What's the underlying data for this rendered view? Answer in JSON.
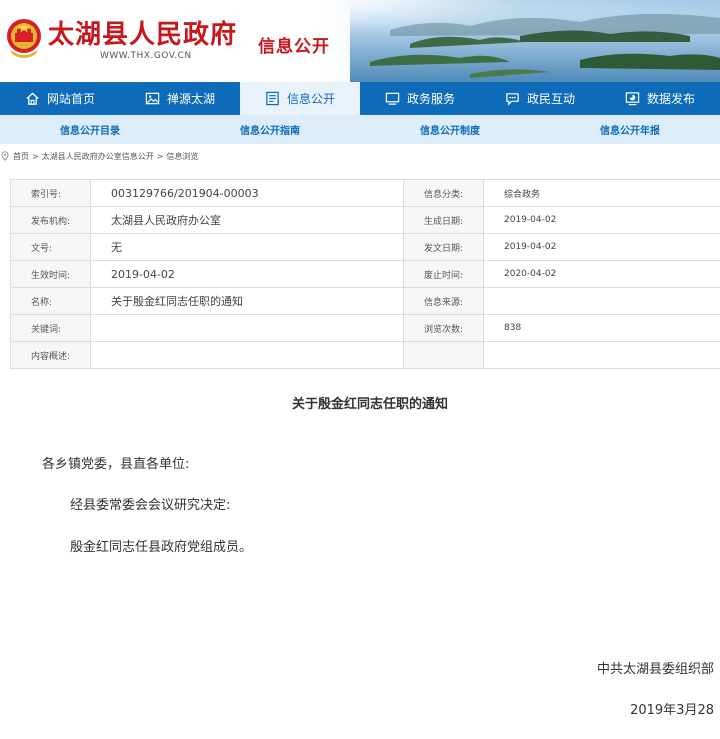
{
  "header": {
    "site_name": "太湖县人民政府",
    "site_url": "WWW.THX.GOV.CN",
    "slogan": "信息公开",
    "emblem_icon": "national-emblem-icon",
    "brand_color": "#c8161d"
  },
  "nav": {
    "color": "#0e6bb9",
    "items": [
      {
        "label": "网站首页",
        "icon": "home-icon"
      },
      {
        "label": "禅源太湖",
        "icon": "image-icon"
      },
      {
        "label": "信息公开",
        "icon": "document-list-icon",
        "active": true
      },
      {
        "label": "政务服务",
        "icon": "monitor-icon"
      },
      {
        "label": "政民互动",
        "icon": "chat-icon"
      },
      {
        "label": "数据发布",
        "icon": "data-release-icon"
      }
    ]
  },
  "subnav": {
    "items": [
      "信息公开目录",
      "信息公开指南",
      "信息公开制度",
      "信息公开年报"
    ]
  },
  "breadcrumb": {
    "icon": "location-pin-icon",
    "items": [
      "首页",
      "太湖县人民政府办公室信息公开",
      "信息浏览"
    ],
    "separator": ">"
  },
  "info": {
    "rows": [
      {
        "l1": "索引号:",
        "v1": "003129766/201904-00003",
        "l2": "信息分类:",
        "v2": "综合政务"
      },
      {
        "l1": "发布机构:",
        "v1": "太湖县人民政府办公室",
        "l2": "生成日期:",
        "v2": "2019-04-02"
      },
      {
        "l1": "文号:",
        "v1": "无",
        "l2": "发文日期:",
        "v2": "2019-04-02"
      },
      {
        "l1": "生效时间:",
        "v1": "2019-04-02",
        "l2": "废止时间:",
        "v2": "2020-04-02"
      },
      {
        "l1": "名称:",
        "v1": "关于殷金红同志任职的通知",
        "l2": "信息来源:",
        "v2": ""
      },
      {
        "l1": "关键词:",
        "v1": "",
        "l2": "浏览次数:",
        "v2": "838"
      },
      {
        "l1": "内容概述:",
        "v1": "",
        "l2": "",
        "v2": ""
      }
    ]
  },
  "article": {
    "title": "关于殷金红同志任职的通知",
    "salutation": "各乡镇党委，县直各单位:",
    "paragraphs": [
      "经县委常委会会议研究决定:",
      "殷金红同志任县政府党组成员。"
    ],
    "signature_org": "中共太湖县委组织部",
    "signature_date": "2019年3月28"
  }
}
